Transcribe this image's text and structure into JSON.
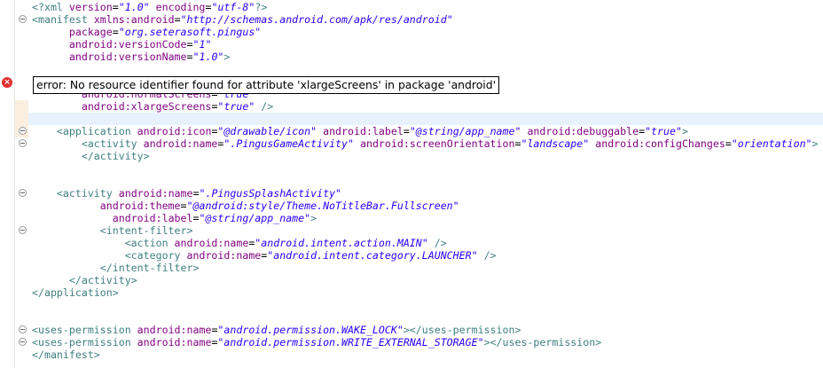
{
  "tooltip": {
    "message": "error: No resource identifier found for attribute 'xlargeScreens' in package 'android'"
  },
  "gutter": {
    "error_icon": "x-circle-icon",
    "fold_icon": "collapse-minus-icon"
  },
  "code_lines": [
    {
      "indent": "",
      "tokens": [
        [
          "tag",
          "<?xml "
        ],
        [
          "attr",
          "version"
        ],
        [
          "txt",
          "="
        ],
        [
          "val",
          "\"1.0\""
        ],
        [
          "attr",
          " encoding"
        ],
        [
          "txt",
          "="
        ],
        [
          "val",
          "\"utf-8\""
        ],
        [
          "tag",
          "?>"
        ]
      ]
    },
    {
      "indent": "",
      "tokens": [
        [
          "tag",
          "<manifest "
        ],
        [
          "attr",
          "xmlns:android"
        ],
        [
          "txt",
          "="
        ],
        [
          "val",
          "\"http://schemas.android.com/apk/res/android\""
        ]
      ]
    },
    {
      "indent": "      ",
      "tokens": [
        [
          "attr",
          "package"
        ],
        [
          "txt",
          "="
        ],
        [
          "val",
          "\"org.seterasoft.pingus\""
        ]
      ]
    },
    {
      "indent": "      ",
      "tokens": [
        [
          "attr",
          "android:versionCode"
        ],
        [
          "txt",
          "="
        ],
        [
          "val",
          "\"1\""
        ]
      ]
    },
    {
      "indent": "      ",
      "tokens": [
        [
          "attr",
          "android:versionName"
        ],
        [
          "txt",
          "="
        ],
        [
          "val",
          "\"1.0\""
        ],
        [
          "tag",
          ">"
        ]
      ]
    },
    {
      "indent": "",
      "tokens": []
    },
    {
      "indent": "",
      "tokens": []
    },
    {
      "indent": "        ",
      "tokens": [
        [
          "attr",
          "android:normalScreens"
        ],
        [
          "txt",
          "="
        ],
        [
          "val",
          "\"true\""
        ]
      ]
    },
    {
      "indent": "        ",
      "tokens": [
        [
          "attr",
          "android:xlargeScreens"
        ],
        [
          "txt",
          "="
        ],
        [
          "val",
          "\"true\""
        ],
        [
          "tag",
          " />"
        ]
      ]
    },
    {
      "indent": "",
      "tokens": []
    },
    {
      "indent": "    ",
      "tokens": [
        [
          "tag",
          "<application "
        ],
        [
          "attr",
          "android:icon"
        ],
        [
          "txt",
          "="
        ],
        [
          "val",
          "\"@drawable/icon\""
        ],
        [
          "attr",
          " android:label"
        ],
        [
          "txt",
          "="
        ],
        [
          "val",
          "\"@string/app_name\""
        ],
        [
          "attr",
          " android:debuggable"
        ],
        [
          "txt",
          "="
        ],
        [
          "val",
          "\"true\""
        ],
        [
          "tag",
          ">"
        ]
      ]
    },
    {
      "indent": "        ",
      "tokens": [
        [
          "tag",
          "<activity "
        ],
        [
          "attr",
          "android:name"
        ],
        [
          "txt",
          "="
        ],
        [
          "val",
          "\".PingusGameActivity\""
        ],
        [
          "attr",
          " android:screenOrientation"
        ],
        [
          "txt",
          "="
        ],
        [
          "val",
          "\"landscape\""
        ],
        [
          "attr",
          " android:configChanges"
        ],
        [
          "txt",
          "="
        ],
        [
          "val",
          "\"orientation\""
        ],
        [
          "tag",
          ">"
        ]
      ]
    },
    {
      "indent": "        ",
      "tokens": [
        [
          "tag",
          "</activity>"
        ]
      ]
    },
    {
      "indent": "",
      "tokens": []
    },
    {
      "indent": "",
      "tokens": []
    },
    {
      "indent": "    ",
      "tokens": [
        [
          "tag",
          "<activity "
        ],
        [
          "attr",
          "android:name"
        ],
        [
          "txt",
          "="
        ],
        [
          "val",
          "\".PingusSplashActivity\""
        ]
      ]
    },
    {
      "indent": "           ",
      "tokens": [
        [
          "attr",
          "android:theme"
        ],
        [
          "txt",
          "="
        ],
        [
          "val",
          "\"@android:style/Theme.NoTitleBar.Fullscreen\""
        ]
      ]
    },
    {
      "indent": "             ",
      "tokens": [
        [
          "attr",
          "android:label"
        ],
        [
          "txt",
          "="
        ],
        [
          "val",
          "\"@string/app_name\""
        ],
        [
          "tag",
          ">"
        ]
      ]
    },
    {
      "indent": "           ",
      "tokens": [
        [
          "tag",
          "<intent-filter>"
        ]
      ]
    },
    {
      "indent": "               ",
      "tokens": [
        [
          "tag",
          "<action "
        ],
        [
          "attr",
          "android:name"
        ],
        [
          "txt",
          "="
        ],
        [
          "val",
          "\"android.intent.action.MAIN\""
        ],
        [
          "tag",
          " />"
        ]
      ]
    },
    {
      "indent": "               ",
      "tokens": [
        [
          "tag",
          "<category "
        ],
        [
          "attr",
          "android:name"
        ],
        [
          "txt",
          "="
        ],
        [
          "val",
          "\"android.intent.category.LAUNCHER\""
        ],
        [
          "tag",
          " />"
        ]
      ]
    },
    {
      "indent": "           ",
      "tokens": [
        [
          "tag",
          "</intent-filter>"
        ]
      ]
    },
    {
      "indent": "      ",
      "tokens": [
        [
          "tag",
          "</activity>"
        ]
      ]
    },
    {
      "indent": "",
      "tokens": [
        [
          "tag",
          "</application>"
        ]
      ]
    },
    {
      "indent": "",
      "tokens": []
    },
    {
      "indent": "",
      "tokens": []
    },
    {
      "indent": "",
      "tokens": [
        [
          "tag",
          "<uses-permission "
        ],
        [
          "attr",
          "android:name"
        ],
        [
          "txt",
          "="
        ],
        [
          "val",
          "\"android.permission.WAKE_LOCK\""
        ],
        [
          "tag",
          "></uses-permission>"
        ]
      ]
    },
    {
      "indent": "",
      "tokens": [
        [
          "tag",
          "<uses-permission "
        ],
        [
          "attr",
          "android:name"
        ],
        [
          "txt",
          "="
        ],
        [
          "val",
          "\"android.permission.WRITE_EXTERNAL_STORAGE\""
        ],
        [
          "tag",
          "></uses-permission>"
        ]
      ]
    },
    {
      "indent": "",
      "tokens": [
        [
          "tag",
          "</manifest>"
        ]
      ]
    }
  ]
}
